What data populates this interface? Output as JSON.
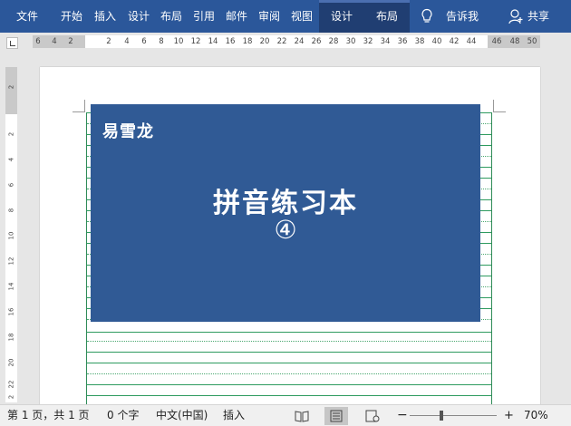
{
  "ribbon": {
    "tabs": [
      "文件",
      "开始",
      "插入",
      "设计",
      "布局",
      "引用",
      "邮件",
      "审阅",
      "视图"
    ],
    "context_tabs": [
      "设计",
      "布局"
    ],
    "tell_me": "告诉我",
    "share": "共享",
    "icons": {
      "tell_me": "lightbulb-icon",
      "share": "person-icon"
    }
  },
  "ruler": {
    "h_left_labels": [
      "6",
      "4",
      "2"
    ],
    "h_labels": [
      "2",
      "4",
      "6",
      "8",
      "10",
      "12",
      "14",
      "16",
      "18",
      "20",
      "22",
      "24",
      "26",
      "28",
      "30",
      "32",
      "34",
      "36",
      "38",
      "40",
      "42",
      "44"
    ],
    "h_right_labels": [
      "46",
      "48",
      "50"
    ],
    "v_labels": [
      "2",
      "2",
      "4",
      "6",
      "8",
      "10",
      "12",
      "14",
      "16",
      "18",
      "20",
      "22",
      "2"
    ]
  },
  "cover": {
    "brand": "易雪龙",
    "title": "拼音练习本",
    "number": "④",
    "color": "#305a95"
  },
  "status": {
    "page": "第 1 页，共 1 页",
    "words": "0 个字",
    "language": "中文(中国)",
    "mode": "插入",
    "zoom_minus": "−",
    "zoom_plus": "+",
    "zoom": "70%",
    "zoom_level_percent": 70
  },
  "colors": {
    "ribbon": "#2b579a",
    "ribbon_context": "#203e72",
    "grid_line": "#2e9b5f"
  }
}
